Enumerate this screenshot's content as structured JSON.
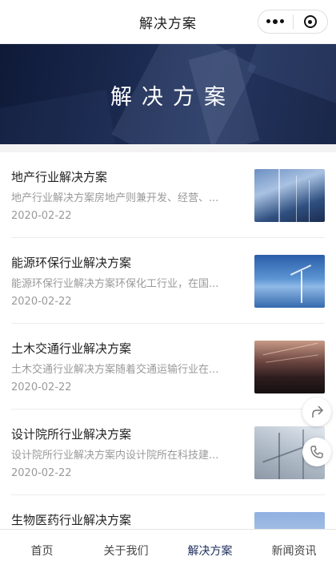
{
  "header": {
    "title": "解决方案"
  },
  "banner": {
    "title": "解决方案"
  },
  "items": [
    {
      "title": "地产行业解决方案",
      "desc": "地产行业解决方案房地产则兼开发、经营、...",
      "date": "2020-02-22",
      "thumb": "skyscraper-photo"
    },
    {
      "title": "能源环保行业解决方案",
      "desc": "能源环保行业解决方案环保化工行业，在国...",
      "date": "2020-02-22",
      "thumb": "wind-turbine-photo"
    },
    {
      "title": "土木交通行业解决方案",
      "desc": "土木交通行业解决方案随着交通运输行业在...",
      "date": "2020-02-22",
      "thumb": "tunnel-photo"
    },
    {
      "title": "设计院所行业解决方案",
      "desc": "设计院所行业解决方案内设计院所在科技建...",
      "date": "2020-02-22",
      "thumb": "steel-structure-photo"
    },
    {
      "title": "生物医药行业解决方案",
      "desc": "",
      "date": "",
      "thumb": "building-photo"
    }
  ],
  "tabbar": {
    "tabs": [
      {
        "label": "首页"
      },
      {
        "label": "关于我们"
      },
      {
        "label": "解决方案"
      },
      {
        "label": "新闻资讯"
      }
    ],
    "active_index": 2
  },
  "colors": {
    "accent": "#1e2e5a",
    "banner": "#1b2a50"
  },
  "floating": {
    "icons": [
      "share-icon",
      "phone-icon"
    ]
  }
}
